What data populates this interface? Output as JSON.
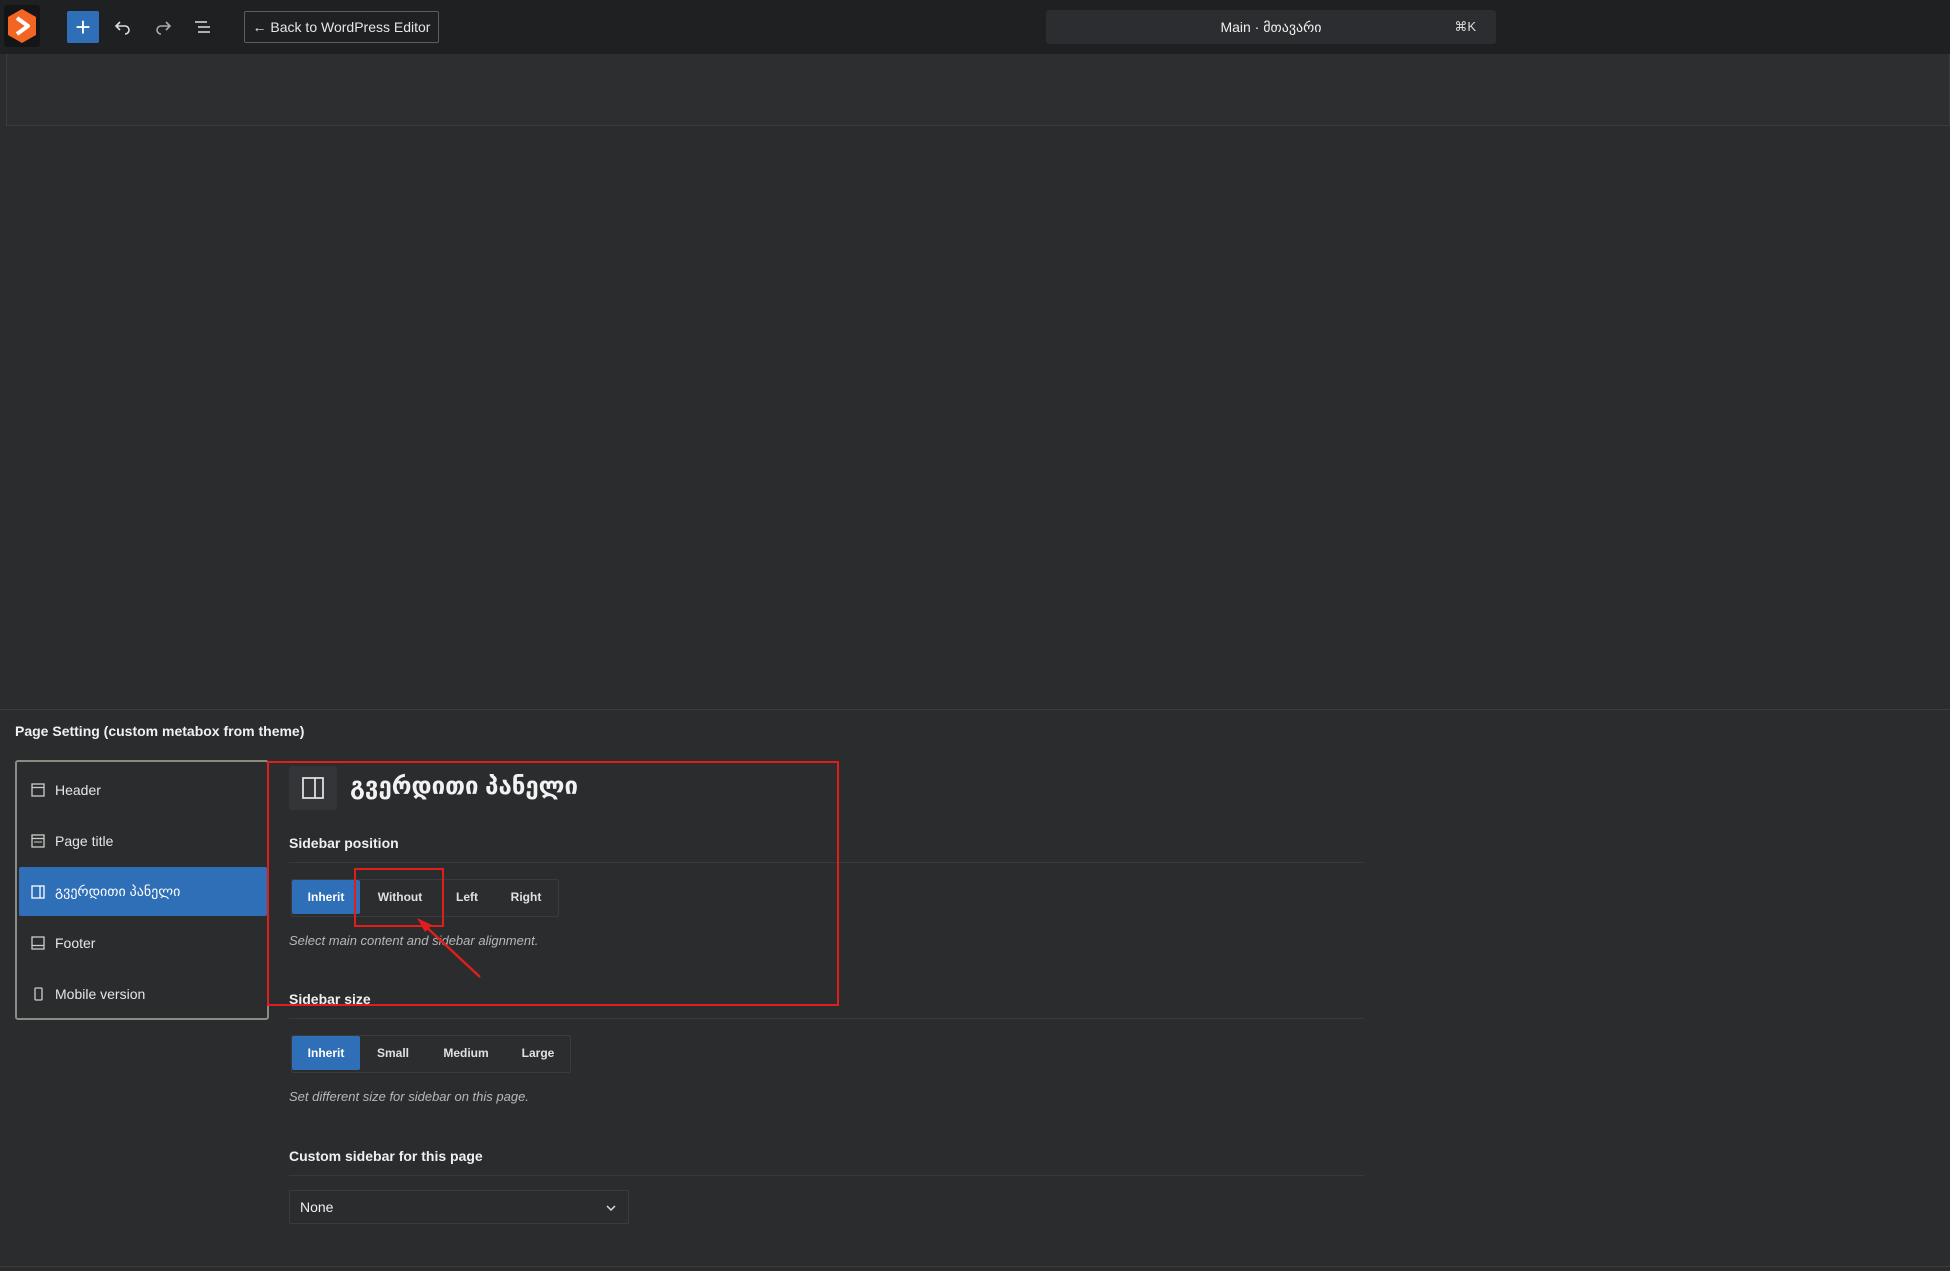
{
  "toolbar": {
    "add_label": "+",
    "back_label": "← Back to WordPress Editor",
    "command_bar": "Main · მთავარი",
    "shortcut": "⌘K"
  },
  "metabox": {
    "title": "Page Setting (custom metabox from theme)"
  },
  "tabs": [
    {
      "label": "Header",
      "icon": "header-icon",
      "active": false
    },
    {
      "label": "Page title",
      "icon": "page-title-icon",
      "active": false
    },
    {
      "label": "გვერდითი პანელი",
      "icon": "sidebar-icon",
      "active": true
    },
    {
      "label": "Footer",
      "icon": "footer-icon",
      "active": false
    },
    {
      "label": "Mobile version",
      "icon": "mobile-icon",
      "active": false
    }
  ],
  "panel": {
    "title": "გვერდითი პანელი",
    "sidebar_position": {
      "label": "Sidebar position",
      "options": [
        "Inherit",
        "Without",
        "Left",
        "Right"
      ],
      "selected": "Inherit",
      "help": "Select main content and sidebar alignment."
    },
    "sidebar_size": {
      "label": "Sidebar size",
      "options": [
        "Inherit",
        "Small",
        "Medium",
        "Large"
      ],
      "selected": "Inherit",
      "help": "Set different size for sidebar on this page."
    },
    "custom_sidebar": {
      "label": "Custom sidebar for this page",
      "value": "None"
    }
  },
  "colors": {
    "accent": "#2f6fb7",
    "annotation": "#e01e1e",
    "logo": "#f26522"
  }
}
